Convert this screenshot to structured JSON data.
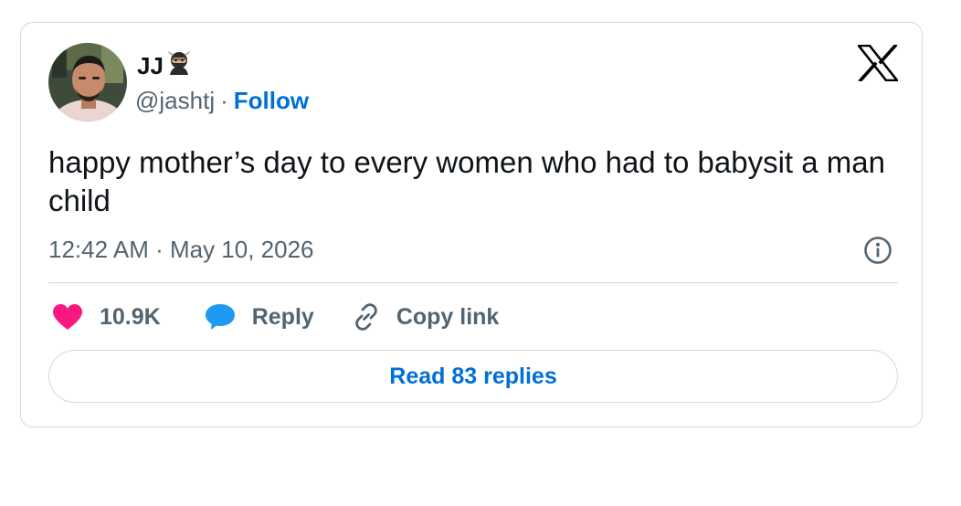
{
  "author": {
    "display_name": "JJ",
    "name_emoji": "ninja-emoji",
    "handle": "@jashtj",
    "separator": "·",
    "follow_label": "Follow"
  },
  "brand": {
    "logo": "x-logo-icon"
  },
  "tweet": {
    "text": "happy mother’s day to every women who had to babysit a man child",
    "timestamp": "12:42 AM · May 10, 2026"
  },
  "actions": {
    "like_count": "10.9K",
    "reply_label": "Reply",
    "copy_link_label": "Copy link"
  },
  "footer": {
    "read_replies_label": "Read 83 replies"
  },
  "colors": {
    "accent": "#006fd6",
    "like": "#f91880",
    "reply": "#1d9bf0",
    "text": "#0f1419",
    "muted": "#536471",
    "border": "#cfd9de"
  }
}
